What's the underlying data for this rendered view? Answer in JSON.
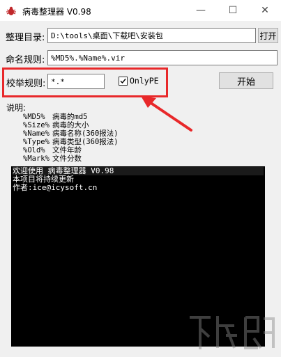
{
  "window": {
    "title": "病毒整理器 V0.98",
    "minimize": "—",
    "maximize": "☐",
    "close": "✕"
  },
  "directory": {
    "label": "整理目录:",
    "value": "D:\\tools\\桌面\\下载吧\\安装包",
    "open_button": "打开"
  },
  "naming": {
    "label": "命名规则:",
    "value": "%MD5%.%Name%.vir"
  },
  "enumerate": {
    "label": "校举规则:",
    "value": "*.*",
    "onlype_label": "OnlyPE",
    "onlype_checked": true,
    "start_button": "开始"
  },
  "description": {
    "title": "说明:",
    "items": [
      {
        "code": "%MD5%",
        "text": "病毒的md5"
      },
      {
        "code": "%Size%",
        "text": "病毒的大小"
      },
      {
        "code": "%Name%",
        "text": "病毒名称(360报法)"
      },
      {
        "code": "%Type%",
        "text": "病毒类型(360报法)"
      },
      {
        "code": "%Old%",
        "text": "文件年龄"
      },
      {
        "code": "%Mark%",
        "text": "文件分数"
      }
    ]
  },
  "console": {
    "lines": [
      "欢迎使用 病毒整理器 V0.98",
      "本项目将持续更新",
      "作者:ice@icysoft.cn"
    ]
  },
  "colors": {
    "highlight": "#e8282a",
    "console_bg": "#000000"
  },
  "watermark_icon": "download-site-logo-icon"
}
